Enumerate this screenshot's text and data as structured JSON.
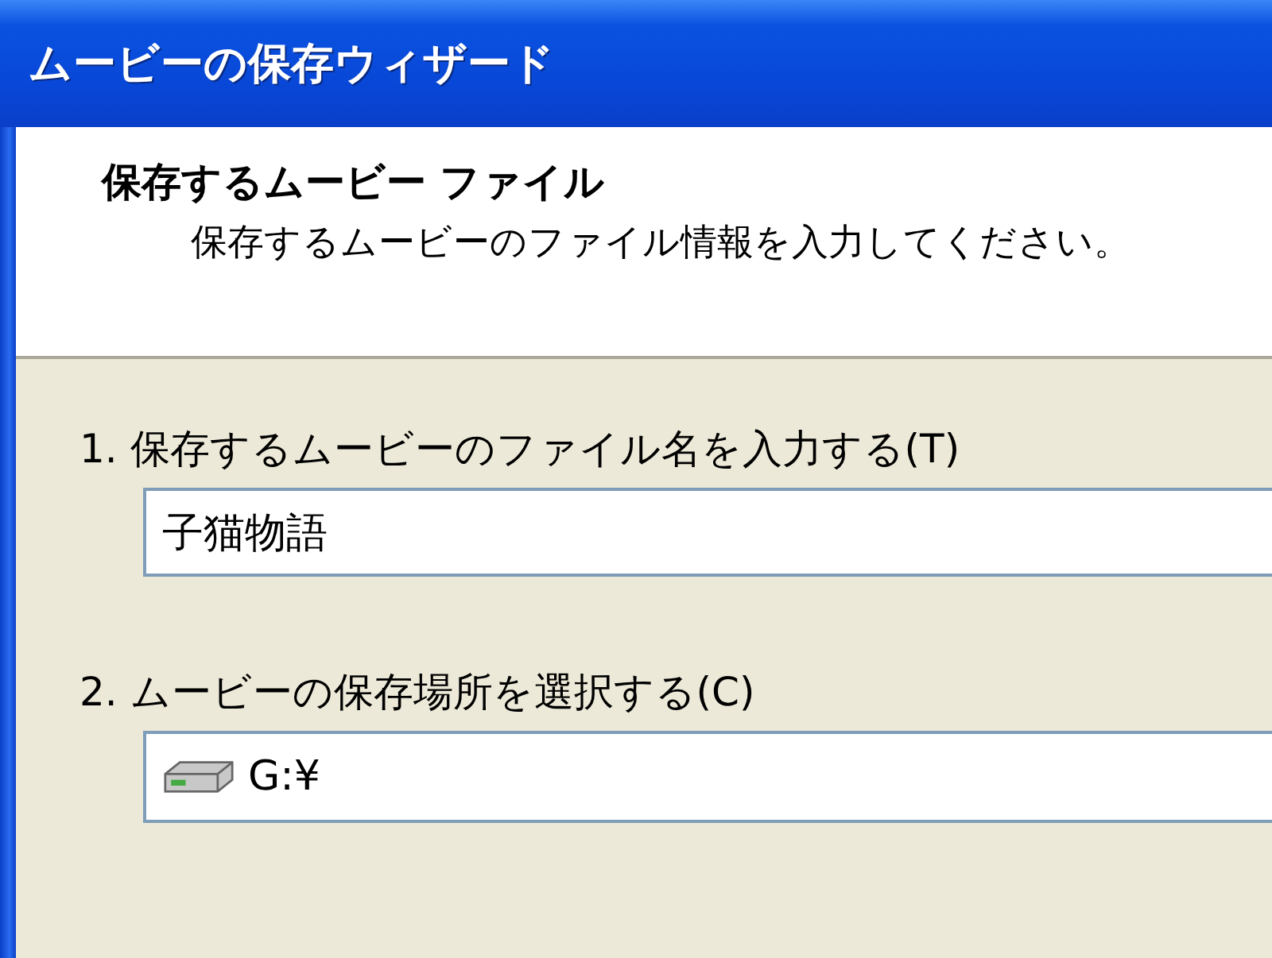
{
  "window": {
    "title": "ムービーの保存ウィザード"
  },
  "header": {
    "title": "保存するムービー ファイル",
    "subtitle": "保存するムービーのファイル情報を入力してください。"
  },
  "fields": [
    {
      "kind": "text",
      "label": "1. 保存するムービーのファイル名を入力する(T)",
      "value": "子猫物語"
    },
    {
      "kind": "drive",
      "label": "2. ムービーの保存場所を選択する(C)",
      "value": "G:¥"
    }
  ]
}
